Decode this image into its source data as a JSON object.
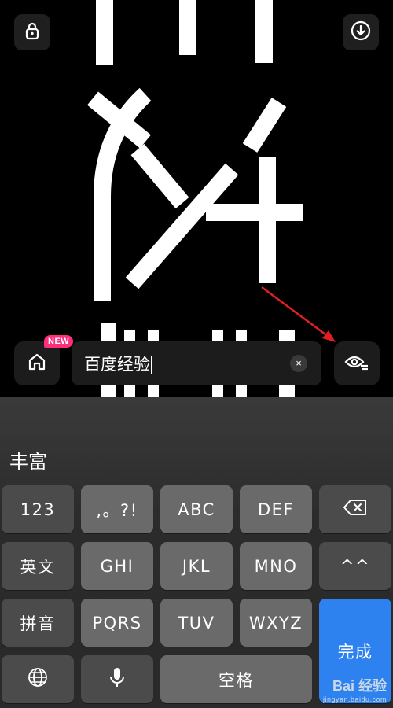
{
  "header": {
    "lock_icon": "lock-icon",
    "download_icon": "download-icon"
  },
  "toolbar": {
    "home_icon": "home-icon",
    "new_badge": "NEW",
    "search_value": "百度经验",
    "clear_label": "×",
    "action_icon": "eye-settings-icon"
  },
  "keyboard": {
    "candidate": "丰富",
    "row1": [
      "123",
      ",。?!",
      "ABC",
      "DEF"
    ],
    "row2": [
      "英文",
      "GHI",
      "JKL",
      "MNO",
      "^^"
    ],
    "row3": [
      "拼音",
      "PQRS",
      "TUV",
      "WXYZ"
    ],
    "done_label": "完成",
    "space_label": "空格",
    "delete_icon": "backspace-icon",
    "globe_icon": "globe-icon",
    "mic_icon": "microphone-icon",
    "accent_color": "#2d82f0"
  },
  "watermark": {
    "brand": "Bai 经验",
    "url": "jingyan.baidu.com"
  }
}
